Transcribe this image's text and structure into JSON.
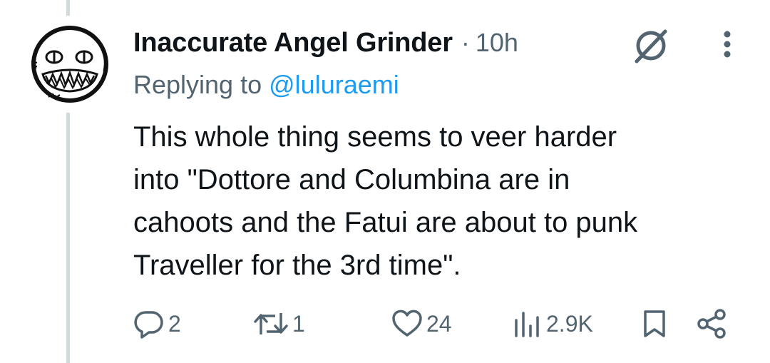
{
  "tweet": {
    "author_name": "Inaccurate Angel Grinder",
    "separator": "·",
    "time": "10h",
    "reply_prefix": "Replying to",
    "reply_handle": "@luluraemi",
    "text_lines": [
      "This whole thing seems to veer harder",
      "into \"Dottore and Columbina are in",
      "cahoots and the Fatui are about to punk",
      "Traveller for the 3rd time\"."
    ]
  },
  "actions": {
    "reply_count": "2",
    "repost_count": "1",
    "like_count": "24",
    "views_count": "2.9K"
  },
  "icons": [
    "avatar-drawing",
    "grok-icon",
    "more-icon",
    "reply-icon",
    "repost-icon",
    "like-icon",
    "views-icon",
    "bookmark-icon",
    "share-icon"
  ],
  "colors": {
    "text": "#0f1419",
    "secondary": "#536471",
    "link": "#1d9bf0",
    "thread_line": "#cfd9de"
  }
}
